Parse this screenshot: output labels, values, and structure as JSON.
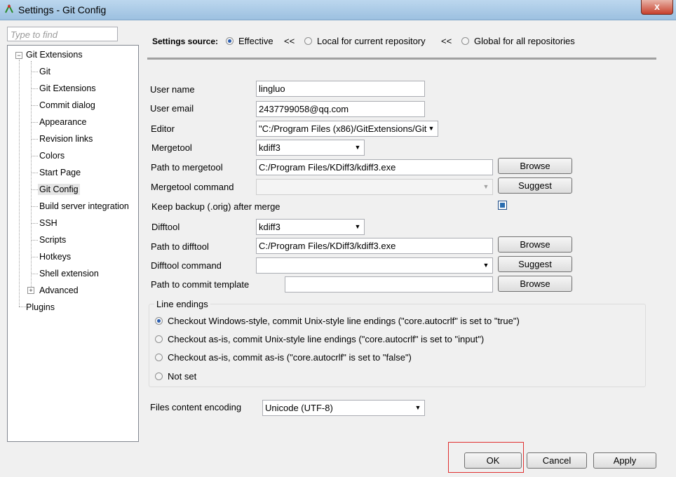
{
  "window": {
    "title": "Settings - Git Config",
    "close_label": "x"
  },
  "search": {
    "placeholder": "Type to find"
  },
  "tree": {
    "root": "Git Extensions",
    "items": [
      "Git",
      "Git Extensions",
      "Commit dialog",
      "Appearance",
      "Revision links",
      "Colors",
      "Start Page",
      "Git Config",
      "Build server integration",
      "SSH",
      "Scripts",
      "Hotkeys",
      "Shell extension",
      "Advanced"
    ],
    "plugins": "Plugins",
    "selected": "Git Config",
    "root_expander": "−",
    "advanced_expander": "+"
  },
  "source": {
    "label": "Settings source:",
    "effective": "Effective",
    "sep1": "<<",
    "local": "Local for current repository",
    "sep2": "<<",
    "global": "Global for all repositories",
    "selected": "Effective"
  },
  "form": {
    "user_name_label": "User name",
    "user_name": "lingluo",
    "user_email_label": "User email",
    "user_email": "2437799058@qq.com",
    "editor_label": "Editor",
    "editor": "\"C:/Program Files (x86)/GitExtensions/Git",
    "mergetool_label": "Mergetool",
    "mergetool": "kdiff3",
    "mergetool_path_label": "Path to mergetool",
    "mergetool_path": "C:/Program Files/KDiff3/kdiff3.exe",
    "mergetool_cmd_label": "Mergetool command",
    "mergetool_cmd": "",
    "keep_backup_label": "Keep backup (.orig) after merge",
    "keep_backup_checked": true,
    "difftool_label": "Difftool",
    "difftool": "kdiff3",
    "difftool_path_label": "Path to difftool",
    "difftool_path": "C:/Program Files/KDiff3/kdiff3.exe",
    "difftool_cmd_label": "Difftool command",
    "difftool_cmd": "",
    "commit_template_label": "Path to commit template",
    "commit_template": "",
    "browse": "Browse",
    "suggest": "Suggest"
  },
  "line_endings": {
    "title": "Line endings",
    "options": [
      "Checkout Windows-style, commit Unix-style line endings (\"core.autocrlf\"  is set to \"true\")",
      "Checkout as-is, commit Unix-style line endings (\"core.autocrlf\"  is set to \"input\")",
      "Checkout as-is, commit as-is (\"core.autocrlf\"  is set to \"false\")",
      "Not set"
    ],
    "selected_index": 0
  },
  "encoding": {
    "label": "Files content encoding",
    "value": "Unicode (UTF-8)"
  },
  "buttons": {
    "ok": "OK",
    "cancel": "Cancel",
    "apply": "Apply"
  },
  "colors": {
    "titlebar": "#9cc0e0",
    "close": "#c8402c",
    "highlight": "#e03030",
    "radio_dot": "#2a5db0"
  }
}
